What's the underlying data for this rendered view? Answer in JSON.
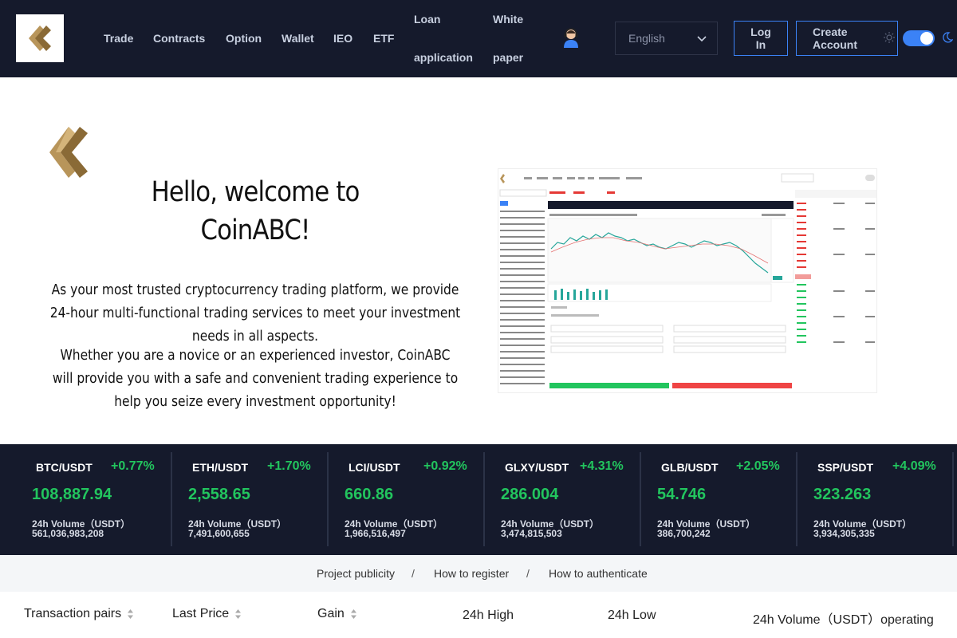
{
  "header": {
    "nav": [
      {
        "label": "Trade"
      },
      {
        "label": "Contracts"
      },
      {
        "label": "Option"
      },
      {
        "label": "Wallet"
      },
      {
        "label": "IEO"
      },
      {
        "label": "ETF"
      }
    ],
    "loan": {
      "line1": "Loan",
      "line2": "application"
    },
    "whitepaper": {
      "line1": "White",
      "line2": "paper"
    },
    "language": "English",
    "login": {
      "line1": "Log",
      "line2": "In"
    },
    "create": {
      "line1": "Create",
      "line2": "Account"
    },
    "theme_toggle_on": true,
    "accent_color": "#3b82f6",
    "icons": [
      "logo-icon",
      "support-agent-icon",
      "chevron-down-icon",
      "sun-icon",
      "moon-icon"
    ]
  },
  "hero": {
    "title_line1": "Hello, welcome to",
    "title_line2": "CoinABC!",
    "paragraph1": "As your most trusted cryptocurrency trading platform, we provide 24-hour multi-functional trading services to meet your investment needs in all aspects.",
    "paragraph2": "Whether you are a novice or an experienced investor, CoinABC will provide you with a safe and convenient trading experience to help you seize every investment opportunity!"
  },
  "tickers": [
    {
      "pair": "BTC/USDT",
      "change": "+0.77%",
      "price": "108,887.94",
      "vol_label": "24h Volume（USDT）",
      "volume": "561,036,983,208"
    },
    {
      "pair": "ETH/USDT",
      "change": "+1.70%",
      "price": "2,558.65",
      "vol_label": "24h Volume（USDT）",
      "volume": "7,491,600,655"
    },
    {
      "pair": "LCI/USDT",
      "change": "+0.92%",
      "price": "660.86",
      "vol_label": "24h Volume（USDT）",
      "volume": "1,966,516,497"
    },
    {
      "pair": "GLXY/USDT",
      "change": "+4.31%",
      "price": "286.004",
      "vol_label": "24h Volume（USDT）",
      "volume": "3,474,815,503"
    },
    {
      "pair": "GLB/USDT",
      "change": "+2.05%",
      "price": "54.746",
      "vol_label": "24h Volume（USDT）",
      "volume": "386,700,242"
    },
    {
      "pair": "SSP/USDT",
      "change": "+4.09%",
      "price": "323.263",
      "vol_label": "24h Volume（USDT）",
      "volume": "3,934,305,335"
    }
  ],
  "positive_color": "#22c55e",
  "links": [
    "Project publicity",
    "How to register",
    "How to authenticate"
  ],
  "link_separator": "/",
  "table_headers": {
    "pair": "Transaction pairs",
    "last_price": "Last Price",
    "gain": "Gain",
    "high": "24h High",
    "low": "24h Low",
    "volume": "24h Volume（USDT）operating"
  }
}
